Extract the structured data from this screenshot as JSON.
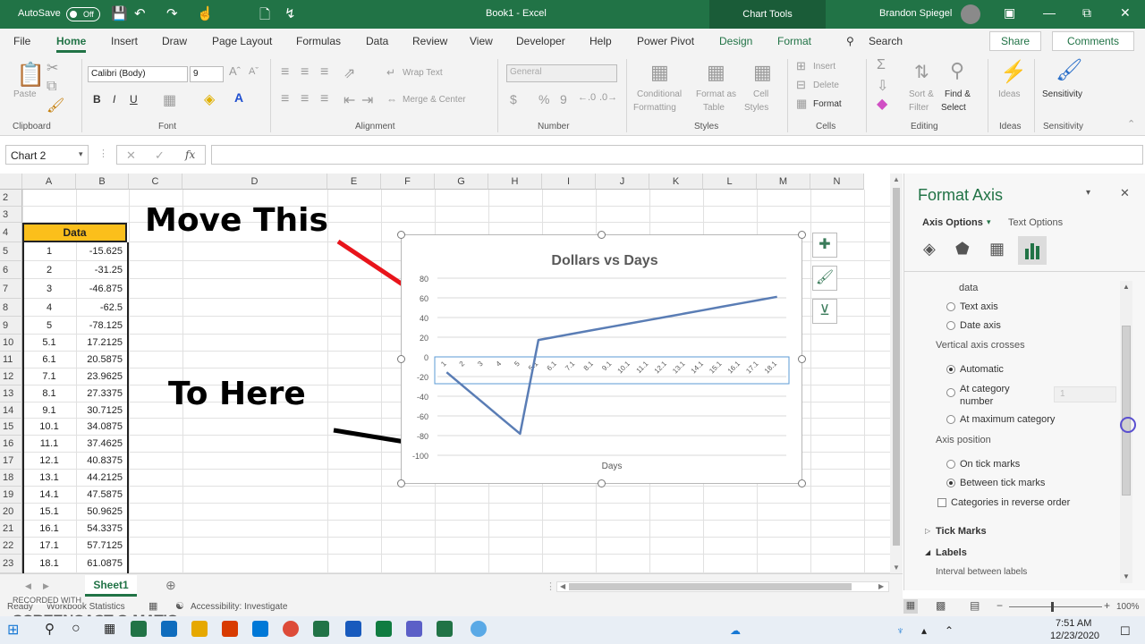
{
  "titlebar": {
    "autosave_label": "AutoSave",
    "autosave_state": "Off",
    "document_title": "Book1 - Excel",
    "chart_tools_label": "Chart Tools",
    "user_name": "Brandon Spiegel"
  },
  "menu": {
    "tabs": [
      "File",
      "Home",
      "Insert",
      "Draw",
      "Page Layout",
      "Formulas",
      "Data",
      "Review",
      "View",
      "Developer",
      "Help",
      "Power Pivot",
      "Design",
      "Format"
    ],
    "active_tab": "Home",
    "search_label": "Search",
    "share_label": "Share",
    "comments_label": "Comments"
  },
  "ribbon": {
    "clipboard": {
      "paste": "Paste",
      "label": "Clipboard"
    },
    "font": {
      "name": "Calibri (Body)",
      "size": "9",
      "label": "Font",
      "bold": "B",
      "italic": "I",
      "underline": "U"
    },
    "alignment": {
      "wrap_text": "Wrap Text",
      "merge_center": "Merge & Center",
      "label": "Alignment"
    },
    "number": {
      "format": "General",
      "currency": "$",
      "percent": "%",
      "comma": "9",
      "label": "Number"
    },
    "styles": {
      "conditional": "Conditional",
      "formatting": "Formatting",
      "format_as": "Format as",
      "table": "Table",
      "cell": "Cell",
      "styles": "Styles",
      "label": "Styles"
    },
    "cells": {
      "insert": "Insert",
      "delete": "Delete",
      "format": "Format",
      "label": "Cells"
    },
    "editing": {
      "sort": "Sort &",
      "filter": "Filter",
      "find": "Find &",
      "select": "Select",
      "label": "Editing"
    },
    "ideas": {
      "ideas": "Ideas",
      "label": "Ideas"
    },
    "sensitivity": {
      "sensitivity": "Sensitivity",
      "label": "Sensitivity"
    }
  },
  "formula_bar": {
    "name_box": "Chart 2",
    "fx": "fx",
    "value": ""
  },
  "sheet": {
    "columns": [
      "A",
      "B",
      "C",
      "D",
      "E",
      "F",
      "G",
      "H",
      "I",
      "J",
      "K",
      "L",
      "M",
      "N"
    ],
    "rows": [
      "2",
      "3",
      "4",
      "5",
      "6",
      "7",
      "8",
      "9",
      "10",
      "11",
      "12",
      "13",
      "14",
      "15",
      "16",
      "17",
      "18",
      "19",
      "20",
      "21",
      "22",
      "23"
    ],
    "data_header": "Data",
    "col_a": [
      "1",
      "2",
      "3",
      "4",
      "5",
      "5.1",
      "6.1",
      "7.1",
      "8.1",
      "9.1",
      "10.1",
      "11.1",
      "12.1",
      "13.1",
      "14.1",
      "15.1",
      "16.1",
      "17.1",
      "18.1"
    ],
    "col_b": [
      "-15.625",
      "-31.25",
      "-46.875",
      "-62.5",
      "-78.125",
      "17.2125",
      "20.5875",
      "23.9625",
      "27.3375",
      "30.7125",
      "34.0875",
      "37.4625",
      "40.8375",
      "44.2125",
      "47.5875",
      "50.9625",
      "54.3375",
      "57.7125",
      "61.0875"
    ]
  },
  "annotations": {
    "move_this": "Move This",
    "to_here": "To Here"
  },
  "chart_data": {
    "type": "line",
    "title": "Dollars vs Days",
    "xlabel": "Days",
    "ylabel": "",
    "categories": [
      "1",
      "2",
      "3",
      "4",
      "5",
      "5.1",
      "6.1",
      "7.1",
      "8.1",
      "9.1",
      "10.1",
      "11.1",
      "12.1",
      "13.1",
      "14.1",
      "15.1",
      "16.1",
      "17.1",
      "18.1"
    ],
    "series": [
      {
        "values": [
          -15.625,
          -31.25,
          -46.875,
          -62.5,
          -78.125,
          17.2125,
          20.5875,
          23.9625,
          27.3375,
          30.7125,
          34.0875,
          37.4625,
          40.8375,
          44.2125,
          47.5875,
          50.9625,
          54.3375,
          57.7125,
          61.0875
        ]
      }
    ],
    "yticks": [
      80,
      60,
      40,
      20,
      0,
      -20,
      -40,
      -60,
      -80,
      -100
    ],
    "ylim": [
      -100,
      80
    ],
    "grid": true,
    "line_color": "#5a7db5"
  },
  "format_pane": {
    "title": "Format Axis",
    "tab_axis_options": "Axis Options",
    "tab_text_options": "Text Options",
    "text_data": "data",
    "text_axis": "Text axis",
    "date_axis": "Date axis",
    "vertical_axis_crosses": "Vertical axis crosses",
    "automatic": "Automatic",
    "at_category_number": "At category number",
    "category_number_value": "1",
    "at_maximum_category": "At maximum category",
    "axis_position": "Axis position",
    "on_tick_marks": "On tick marks",
    "between_tick_marks": "Between tick marks",
    "categories_reverse": "Categories in reverse order",
    "tick_marks": "Tick Marks",
    "labels": "Labels",
    "interval_between_labels": "Interval between labels"
  },
  "sheet_tabs": {
    "active": "Sheet1"
  },
  "status": {
    "ready": "Ready",
    "workbook_stats": "Workbook Statistics",
    "accessibility": "Accessibility: Investigate",
    "zoom": "100%"
  },
  "taskbar": {
    "time": "7:51 AM",
    "date": "12/23/2020"
  },
  "watermark": {
    "recorded_with": "RECORDED WITH",
    "brand": "SCREENCAST-O-MATIC"
  },
  "colors": {
    "accent": "#217346",
    "data_header_fill": "#fbbf1b",
    "arrow_red": "#e8141b"
  }
}
